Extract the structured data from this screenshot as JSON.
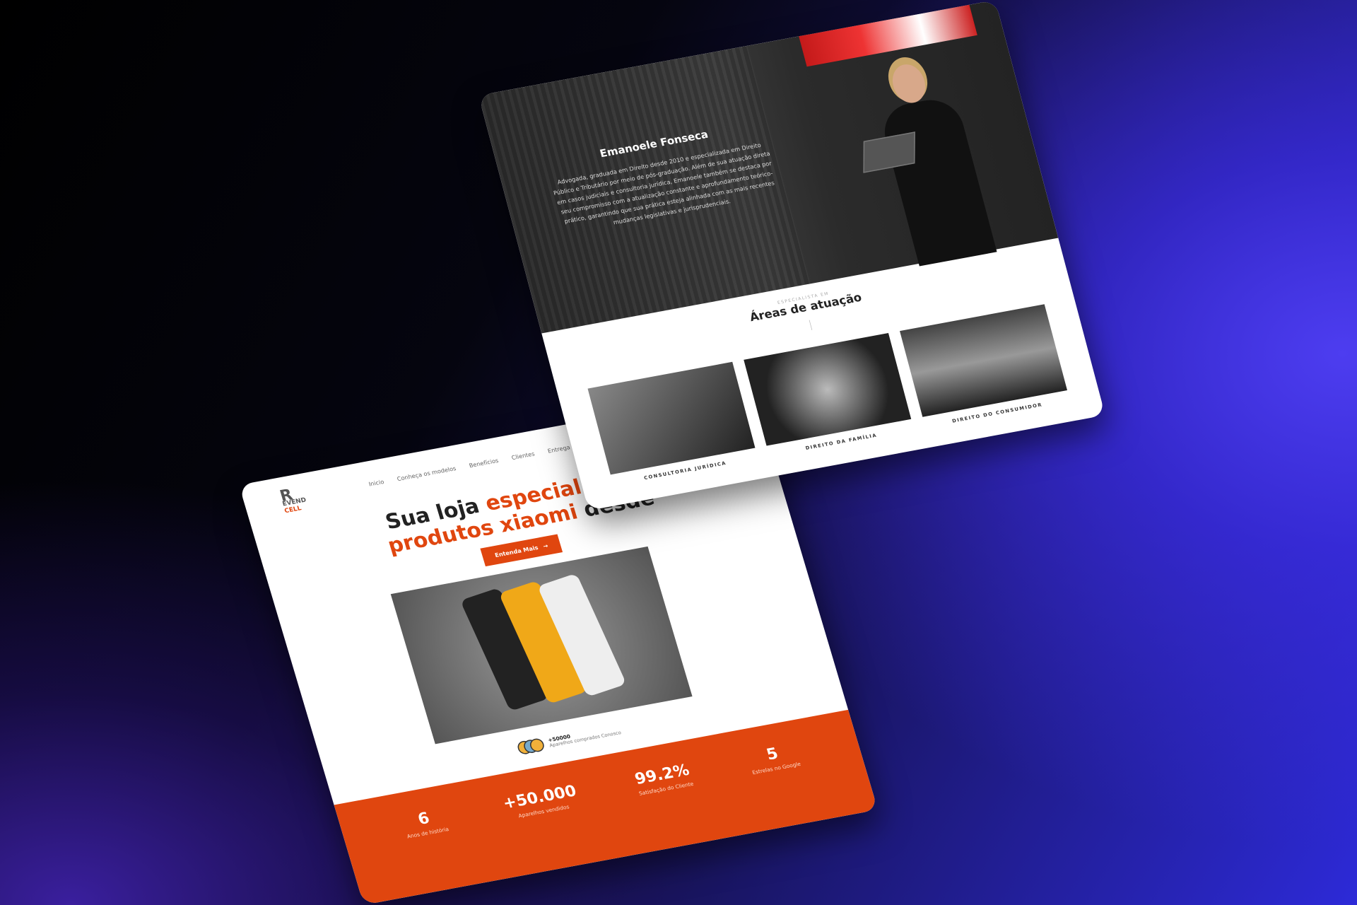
{
  "law_site": {
    "name": "Emanoele Fonseca",
    "bio": "Advogada, graduada em Direito desde 2010 e especializada em Direito Público e Tributário por meio de pós-graduação. Além de sua atuação direta em casos judiciais e consultoria jurídica, Emanoele também se destaca por seu compromisso com a atualização constante e aprofundamento teórico-prático, garantindo que sua prática esteja alinhada com as mais recentes mudanças legislativas e jurisprudenciais.",
    "kicker": "ESPECIALISTA EM",
    "section_title": "Áreas de atuação",
    "areas": [
      {
        "label": "CONSULTORIA JURÍDICA"
      },
      {
        "label": "DIREITO DA FAMÍLIA"
      },
      {
        "label": "DIREITO DO CONSUMIDOR"
      }
    ]
  },
  "store_site": {
    "logo_top": "EVEND",
    "logo_letter": "R",
    "logo_bottom": "CELL",
    "nav": [
      "Inicio",
      "Conheça os modelos",
      "Benefícios",
      "Clientes",
      "Entrega e Ga"
    ],
    "headline_1": "Sua loja ",
    "headline_1_accent": "especializada",
    "headline_2_accent": "produtos xiaomi",
    "headline_2": " desde",
    "cta": "Entenda Mais",
    "cta_icon": "→",
    "social_count": "+50000",
    "social_text": "Aparelhos comprados Conosco",
    "stats": [
      {
        "value": "6",
        "label": "Anos de história"
      },
      {
        "value": "+50.000",
        "label": "Aparelhos vendidos"
      },
      {
        "value": "99.2%",
        "label": "Satisfação do Cliente"
      },
      {
        "value": "5",
        "label": "Estrelas no Google"
      }
    ],
    "accent": "#e0460f"
  }
}
